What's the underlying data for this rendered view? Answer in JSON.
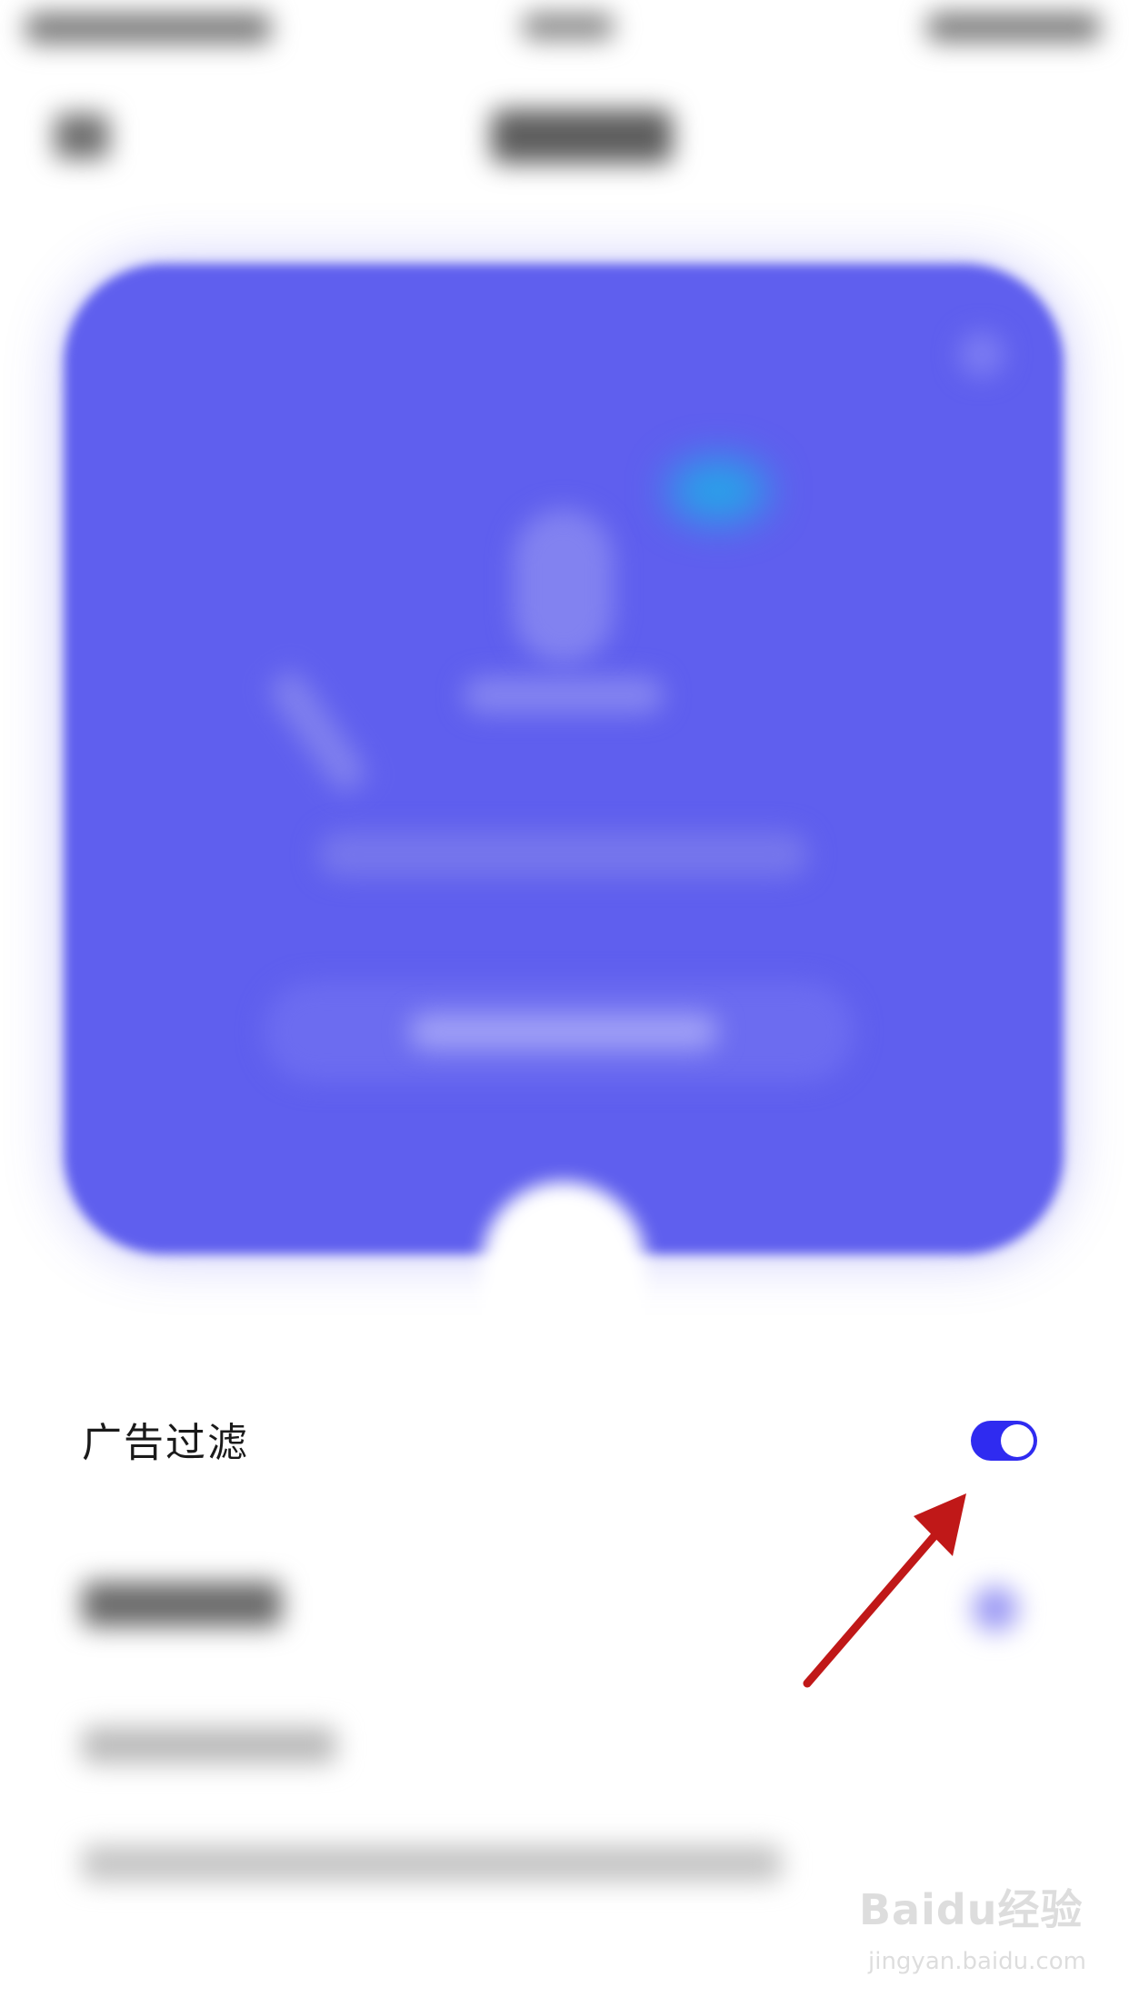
{
  "settings": {
    "ad_filter": {
      "label": "广告过滤",
      "enabled": true
    }
  },
  "colors": {
    "hero_card": "#5f5fee",
    "toggle_on": "#2f2bf0",
    "annotation_arrow": "#c01818"
  },
  "watermark": {
    "brand": "Baidu经验",
    "url": "jingyan.baidu.com"
  }
}
